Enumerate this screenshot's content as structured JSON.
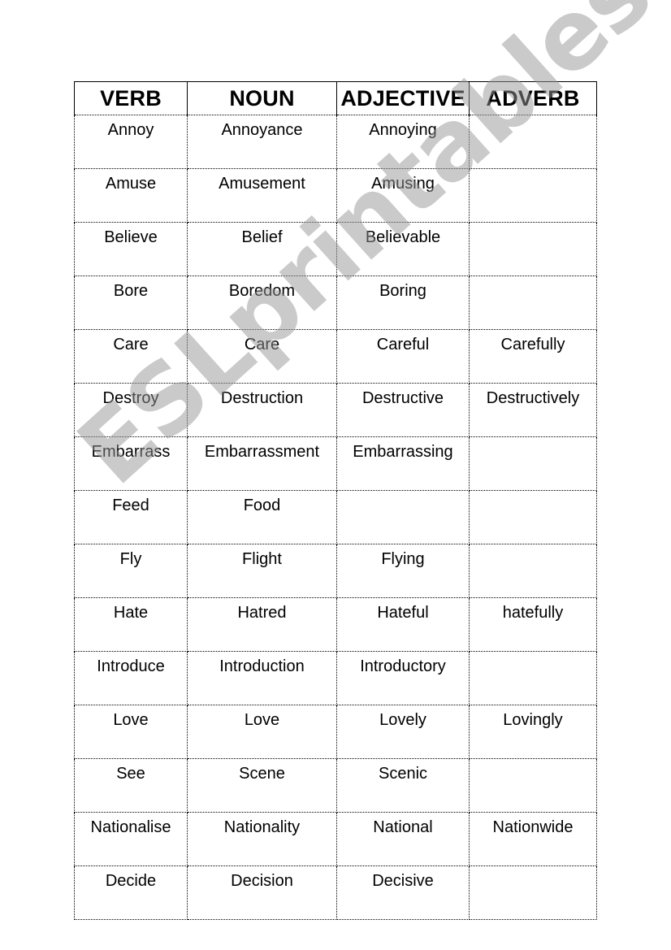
{
  "table": {
    "headers": [
      "VERB",
      "NOUN",
      "ADJECTIVE",
      "ADVERB"
    ],
    "rows": [
      [
        "Annoy",
        "Annoyance",
        "Annoying",
        ""
      ],
      [
        "Amuse",
        "Amusement",
        "Amusing",
        ""
      ],
      [
        "Believe",
        "Belief",
        "Believable",
        ""
      ],
      [
        "Bore",
        "Boredom",
        "Boring",
        ""
      ],
      [
        "Care",
        "Care",
        "Careful",
        "Carefully"
      ],
      [
        "Destroy",
        "Destruction",
        "Destructive",
        "Destructively"
      ],
      [
        "Embarrass",
        "Embarrassment",
        "Embarrassing",
        ""
      ],
      [
        "Feed",
        "Food",
        "",
        ""
      ],
      [
        "Fly",
        "Flight",
        "Flying",
        ""
      ],
      [
        "Hate",
        "Hatred",
        "Hateful",
        "hatefully"
      ],
      [
        "Introduce",
        "Introduction",
        "Introductory",
        ""
      ],
      [
        "Love",
        "Love",
        "Lovely",
        "Lovingly"
      ],
      [
        "See",
        "Scene",
        "Scenic",
        ""
      ],
      [
        "Nationalise",
        "Nationality",
        "National",
        "Nationwide"
      ],
      [
        "Decide",
        "Decision",
        "Decisive",
        ""
      ]
    ]
  },
  "watermark": "ESLprintables.com"
}
